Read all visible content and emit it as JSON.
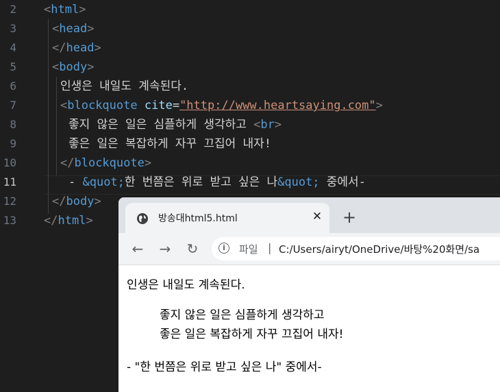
{
  "editor": {
    "lines": [
      {
        "num": "2",
        "tokens": [
          {
            "c": "p",
            "t": "<"
          },
          {
            "c": "t",
            "t": "html"
          },
          {
            "c": "p",
            "t": ">"
          }
        ]
      },
      {
        "num": "3",
        "tokens": [
          {
            "c": "p",
            "t": "<"
          },
          {
            "c": "t",
            "t": "head"
          },
          {
            "c": "p",
            "t": ">"
          }
        ]
      },
      {
        "num": "4",
        "tokens": [
          {
            "c": "p",
            "t": "</"
          },
          {
            "c": "t",
            "t": "head"
          },
          {
            "c": "p",
            "t": ">"
          }
        ]
      },
      {
        "num": "5",
        "tokens": [
          {
            "c": "p",
            "t": "<"
          },
          {
            "c": "t",
            "t": "body"
          },
          {
            "c": "p",
            "t": ">"
          }
        ]
      },
      {
        "num": "6",
        "tokens": [
          {
            "c": "x",
            "t": "인생은 내일도 계속된다."
          }
        ]
      },
      {
        "num": "7",
        "tokens": [
          {
            "c": "p",
            "t": "<"
          },
          {
            "c": "t",
            "t": "blockquote"
          },
          {
            "c": "x",
            "t": " "
          },
          {
            "c": "a",
            "t": "cite"
          },
          {
            "c": "x",
            "t": "="
          },
          {
            "c": "s",
            "t": "\"http://www.heartsaying.com\"",
            "u": true
          },
          {
            "c": "p",
            "t": ">"
          }
        ]
      },
      {
        "num": "8",
        "tokens": [
          {
            "c": "x",
            "t": "좋지 않은 일은 심플하게 생각하고 "
          },
          {
            "c": "p",
            "t": "<"
          },
          {
            "c": "t",
            "t": "br"
          },
          {
            "c": "p",
            "t": ">"
          }
        ]
      },
      {
        "num": "9",
        "tokens": [
          {
            "c": "x",
            "t": "좋은 일은 복잡하게 자꾸 끄집어 내자!"
          }
        ]
      },
      {
        "num": "10",
        "tokens": [
          {
            "c": "p",
            "t": "</"
          },
          {
            "c": "t",
            "t": "blockquote"
          },
          {
            "c": "p",
            "t": ">"
          }
        ]
      },
      {
        "num": "11",
        "tokens": [
          {
            "c": "x",
            "t": "- "
          },
          {
            "c": "t",
            "t": "&quot;"
          },
          {
            "c": "x",
            "t": "한 번쯤은 위로 받고 싶은 나"
          },
          {
            "c": "t",
            "t": "&quot;"
          },
          {
            "c": "x",
            "t": " 중에서-"
          }
        ]
      },
      {
        "num": "12",
        "tokens": [
          {
            "c": "p",
            "t": "</"
          },
          {
            "c": "t",
            "t": "body"
          },
          {
            "c": "p",
            "t": ">"
          }
        ]
      },
      {
        "num": "13",
        "tokens": [
          {
            "c": "p",
            "t": "</"
          },
          {
            "c": "t",
            "t": "html"
          },
          {
            "c": "p",
            "t": ">"
          }
        ]
      }
    ]
  },
  "browser": {
    "tab_title": "방송대html5.html",
    "tab_close": "✕",
    "new_tab": "+",
    "back": "←",
    "forward": "→",
    "reload": "↻",
    "info": "i",
    "url_scheme": "파일",
    "url_separator": "|",
    "url": "C:/Users/airyt/OneDrive/바탕%20화면/sa"
  },
  "page": {
    "line1": "인생은 내일도 계속된다.",
    "quote_line1": "좋지 않은 일은 심플하게 생각하고",
    "quote_line2": "좋은 일은 복잡하게 자꾸 끄집어 내자!",
    "attribution": "- \"한 번쯤은 위로 받고 싶은 나\" 중에서-"
  }
}
